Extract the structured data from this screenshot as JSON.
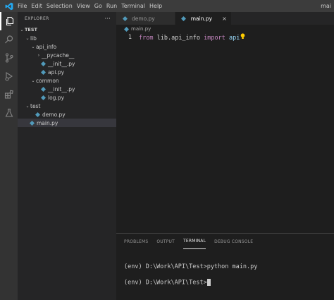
{
  "titlebar": {
    "menu": [
      "File",
      "Edit",
      "Selection",
      "View",
      "Go",
      "Run",
      "Terminal",
      "Help"
    ],
    "title": "mai"
  },
  "activity": [
    "explorer-icon",
    "search-icon",
    "source-control-icon",
    "run-debug-icon",
    "extensions-icon",
    "test-flask-icon"
  ],
  "sidebar": {
    "title": "EXPLORER",
    "more": "···",
    "tree": [
      {
        "label": "TEST",
        "indent": 0,
        "kind": "root",
        "chev": "⌄"
      },
      {
        "label": "lib",
        "indent": 1,
        "kind": "folder",
        "chev": "⌄"
      },
      {
        "label": "api_info",
        "indent": 2,
        "kind": "folder",
        "chev": "⌄"
      },
      {
        "label": "__pycache__",
        "indent": 3,
        "kind": "folder",
        "chev": "›"
      },
      {
        "label": "__init__.py",
        "indent": 3,
        "kind": "file"
      },
      {
        "label": "api.py",
        "indent": 3,
        "kind": "file"
      },
      {
        "label": "common",
        "indent": 2,
        "kind": "folder",
        "chev": "⌄"
      },
      {
        "label": "__init__.py",
        "indent": 3,
        "kind": "file"
      },
      {
        "label": "log.py",
        "indent": 3,
        "kind": "file"
      },
      {
        "label": "test",
        "indent": 1,
        "kind": "folder",
        "chev": "⌄"
      },
      {
        "label": "demo.py",
        "indent": 2,
        "kind": "file"
      },
      {
        "label": "main.py",
        "indent": 1,
        "kind": "file",
        "selected": true
      }
    ]
  },
  "tabs": [
    {
      "label": "demo.py",
      "active": false
    },
    {
      "label": "main.py",
      "active": true,
      "close": "×"
    }
  ],
  "breadcrumb": "main.py",
  "editor": {
    "line_number": "1",
    "kw_from": "from",
    "module": "lib.api_info",
    "kw_import": "import",
    "name": "api"
  },
  "panel": {
    "tabs": [
      "PROBLEMS",
      "OUTPUT",
      "TERMINAL",
      "DEBUG CONSOLE"
    ],
    "active_tab": "TERMINAL",
    "terminal_lines": [
      "(env) D:\\Work\\API\\Test>python main.py",
      "(env) D:\\Work\\API\\Test>"
    ]
  },
  "colors": {
    "python_icon": "#519aba",
    "keyword": "#c586c0",
    "identifier": "#9cdcfe"
  }
}
